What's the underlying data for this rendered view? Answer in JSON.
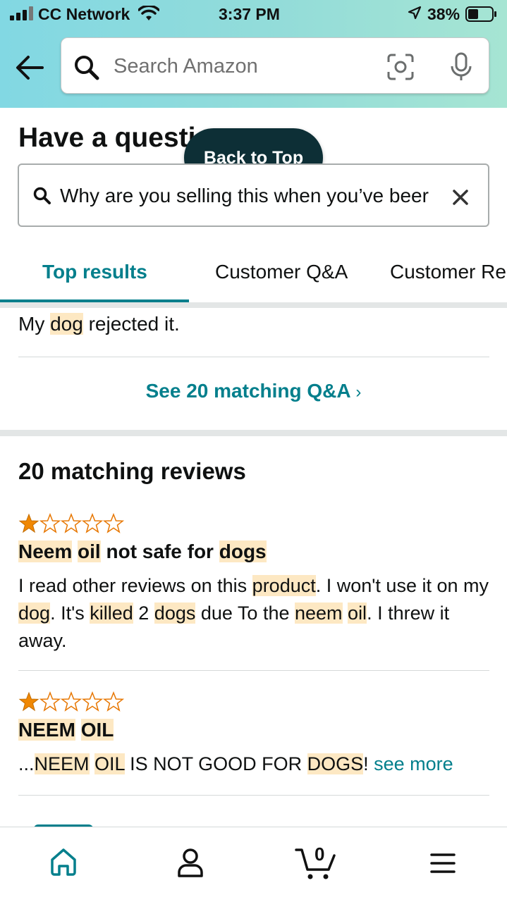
{
  "status_bar": {
    "carrier": "CC Network",
    "time": "3:37 PM",
    "battery": "38%"
  },
  "search": {
    "placeholder": "Search Amazon"
  },
  "question_section": {
    "heading": "Have a questi",
    "back_to_top": "Back to Top",
    "query": "Why are you selling this when you’ve beer"
  },
  "tabs": [
    {
      "label": "Top results"
    },
    {
      "label": "Customer Q&A"
    },
    {
      "label": "Customer Re"
    }
  ],
  "qa_snippet": {
    "parts": [
      "My ",
      "dog",
      " rejected it."
    ]
  },
  "see_qa_link": "See 20 matching Q&A",
  "reviews": {
    "title": "20 matching reviews",
    "items": [
      {
        "rating": 1,
        "title_parts": [
          "Neem",
          " ",
          "oil",
          " not safe for ",
          "dogs"
        ],
        "body_parts": [
          "I read other reviews on this ",
          "product",
          ". I won't use it on my ",
          "dog",
          ". It's ",
          "killed",
          " 2 ",
          "dogs",
          " due To the ",
          "neem",
          " ",
          "oil",
          ". I threw it away."
        ]
      },
      {
        "rating": 1,
        "title_parts": [
          "NEEM",
          " ",
          "OIL"
        ],
        "body_parts": [
          "...",
          "NEEM",
          " ",
          "OIL",
          " IS NOT GOOD FOR ",
          "DOGS",
          "! "
        ],
        "see_more": "see more"
      }
    ]
  },
  "colors": {
    "accent": "#037f8c",
    "highlight": "#fde8c3",
    "star": "#f08804",
    "back_to_top_bg": "#0d2f36"
  },
  "bottom_nav": {
    "cart_count": "0",
    "icons": [
      "home-icon",
      "account-icon",
      "cart-icon",
      "menu-icon"
    ]
  }
}
